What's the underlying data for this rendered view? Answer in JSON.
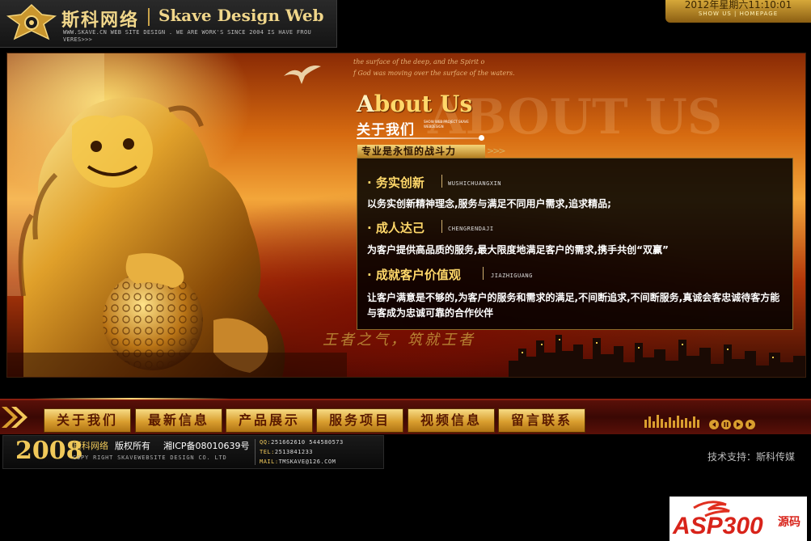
{
  "header": {
    "logo_cn": "斯科网络",
    "logo_en": "Skave Design Web",
    "tagline": "WWW.SKAVE.CN WEB SITE DESIGN . WE ARE WORK'S SINCE 2004 IS HAVE FROU VERES>>>",
    "datetime": "2012年星期六11:10:01",
    "link_show_us": "SHOW US",
    "link_divider": "|",
    "link_homepage": "HOMEPAGE"
  },
  "banner": {
    "sky_line_1": "the surface of the deep, and the Spirit o",
    "sky_line_2": "f God was moving over the surface of the waters.",
    "about_title": "About Us",
    "about_bg_text": "ABOUT US",
    "about_cn": "关于我们",
    "about_mini": "SHOW WEB PROJECT SKAVE WEBDESIGN",
    "slogan": "专业是永恒的战斗力",
    "slogan_arrows": ">>>",
    "watermark": "王者之气，筑就王者",
    "sections": [
      {
        "title": "· 务实创新",
        "en": "WUSHICHUANGXIN",
        "text": "以务实创新精神理念,服务与满足不同用户需求,追求精品;"
      },
      {
        "title": "· 成人达己",
        "en": "CHENGRENDAJI",
        "text": "为客户提供高品质的服务,最大限度地满足客户的需求,携手共创“双赢”"
      },
      {
        "title": "· 成就客户价值观",
        "en": "JIAZHIGUANG",
        "text": "让客户满意是不够的,为客户的服务和需求的满足,不间断追求,不间断服务,真诚会客忠诚待客方能与客成为忠诚可靠的合作伙伴"
      }
    ]
  },
  "nav": {
    "items": [
      "关于我们",
      "最新信息",
      "产品展示",
      "服务项目",
      "视频信息",
      "留言联系"
    ]
  },
  "footer": {
    "year": "2008",
    "brand": "斯科网络",
    "rights": "版权所有",
    "icp": "湘ICP备08010639号",
    "copyright_en": "COPY RIGHT SKAVEWEBSITE DESIGN CO. LTD",
    "qq_label": "QQ:",
    "qq_value": "251662610  544580573",
    "tel_label": "TEL:",
    "tel_value": "2513841233",
    "mail_label": "MAIL:",
    "mail_value": "TMSKAVE@126.COM",
    "support": "技术支持：斯科传媒"
  },
  "watermark_logo": {
    "brand": "ASP300",
    "suffix": "源码"
  },
  "colors": {
    "gold": "#f0c95a",
    "nav_bg": "#3a0804",
    "panel_bg": "#000000"
  }
}
